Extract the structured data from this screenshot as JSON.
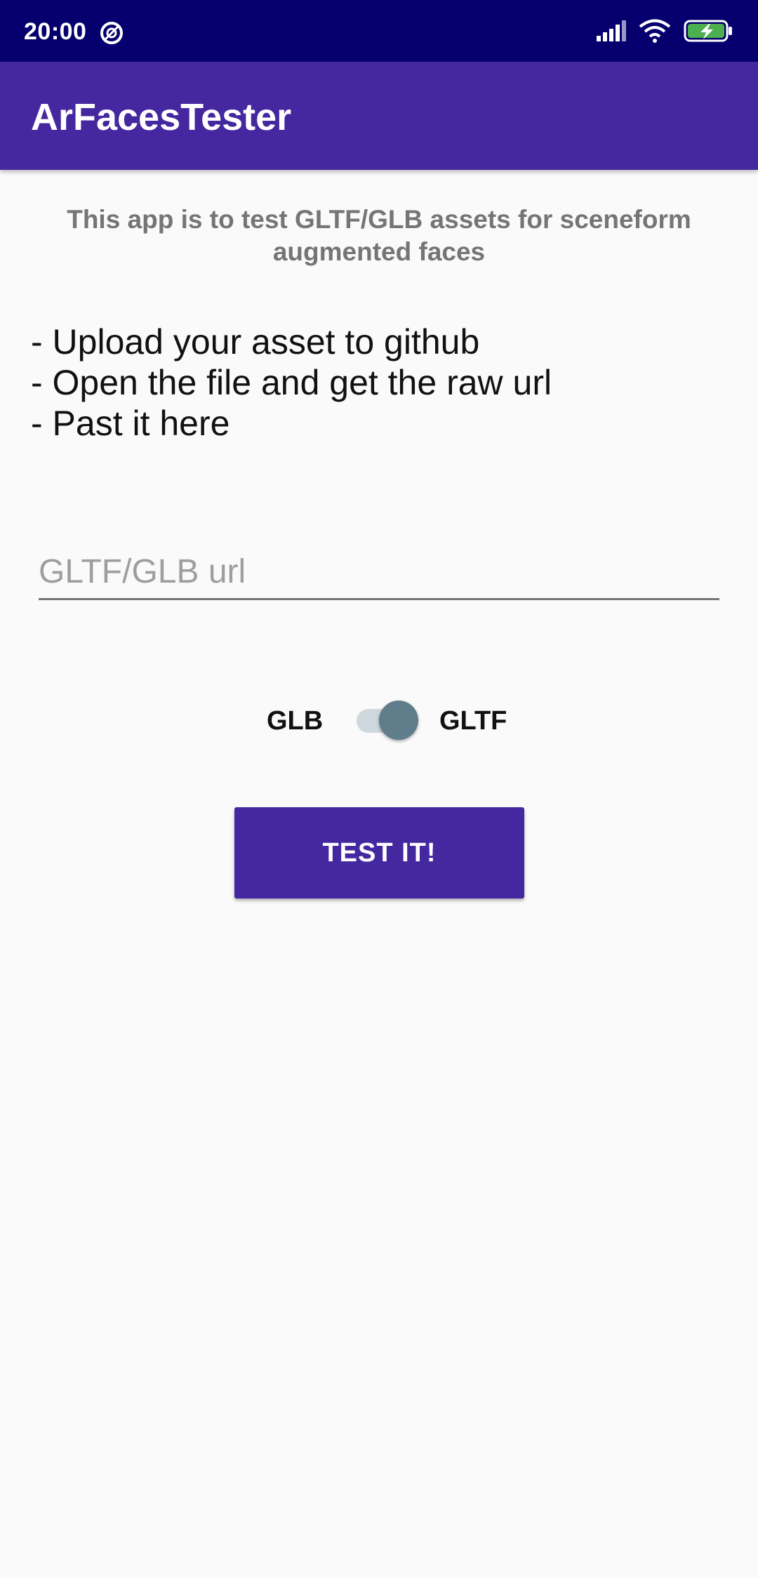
{
  "status_bar": {
    "time": "20:00",
    "icons": [
      "do-not-disturb-icon",
      "signal-icon",
      "wifi-icon",
      "battery-charging-icon"
    ]
  },
  "app_bar": {
    "title": "ArFacesTester"
  },
  "intro": {
    "text": "This app is to test GLTF/GLB assets for sceneform augmented faces"
  },
  "instructions": {
    "lines": [
      "- Upload your asset to github",
      "- Open the file and get the raw url",
      "- Past it here"
    ]
  },
  "url_field": {
    "placeholder": "GLTF/GLB url",
    "value": ""
  },
  "format_toggle": {
    "left_label": "GLB",
    "right_label": "GLTF",
    "checked": true
  },
  "test_button": {
    "label": "TEST IT!"
  },
  "colors": {
    "status_bar": "#05006e",
    "app_bar": "#4527a0",
    "button": "#4527a0",
    "switch_thumb": "#607d8b",
    "switch_track": "#cfd8dc",
    "battery_fill": "#4caf50"
  }
}
